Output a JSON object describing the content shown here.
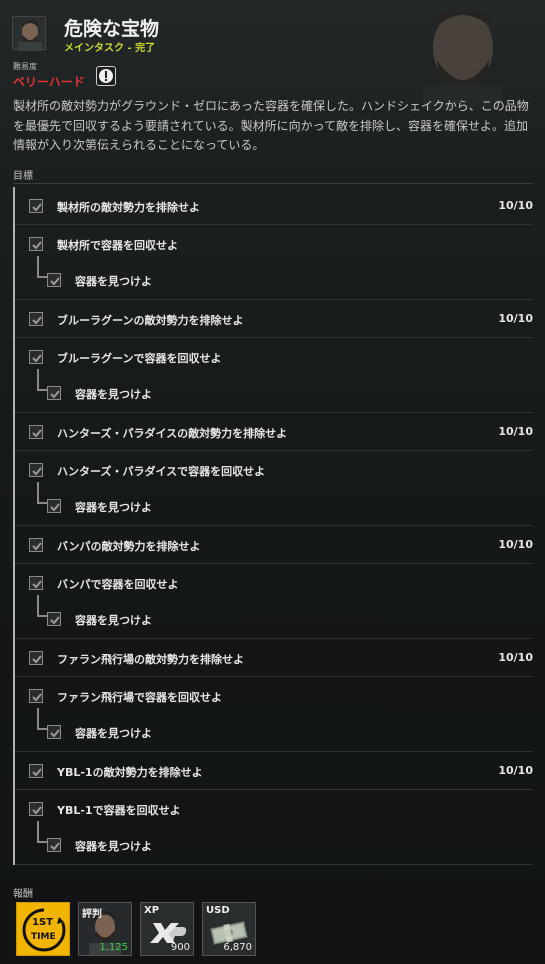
{
  "quest": {
    "title": "危険な宝物",
    "subtitle": "メインタスク - 完了",
    "difficulty_label": "難易度",
    "difficulty": "ベリーハード",
    "description": "製材所の敵対勢力がグラウンド・ゼロにあった容器を確保した。ハンドシェイクから、この品物を最優先で回収するよう要請されている。製材所に向かって敵を排除し、容器を確保せよ。追加情報が入り次第伝えられることになっている。"
  },
  "objectives_label": "目標",
  "objectives": [
    {
      "text": "製材所の敵対勢力を排除せよ",
      "count": "10/10"
    },
    {
      "text": "製材所で容器を回収せよ",
      "sub": "容器を見つけよ"
    },
    {
      "text": "ブルーラグーンの敵対勢力を排除せよ",
      "count": "10/10"
    },
    {
      "text": "ブルーラグーンで容器を回収せよ",
      "sub": "容器を見つけよ"
    },
    {
      "text": "ハンターズ・パラダイスの敵対勢力を排除せよ",
      "count": "10/10"
    },
    {
      "text": "ハンターズ・パラダイスで容器を回収せよ",
      "sub": "容器を見つけよ"
    },
    {
      "text": "バンパの敵対勢力を排除せよ",
      "count": "10/10"
    },
    {
      "text": "バンパで容器を回収せよ",
      "sub": "容器を見つけよ"
    },
    {
      "text": "ファラン飛行場の敵対勢力を排除せよ",
      "count": "10/10"
    },
    {
      "text": "ファラン飛行場で容器を回収せよ",
      "sub": "容器を見つけよ"
    },
    {
      "text": "YBL-1の敵対勢力を排除せよ",
      "count": "10/10"
    },
    {
      "text": "YBL-1で容器を回収せよ",
      "sub": "容器を見つけよ"
    }
  ],
  "rewards_label": "報酬",
  "rewards": {
    "first_time": {
      "text_top": "1ST",
      "text_bottom": "TIME"
    },
    "reputation": {
      "title": "評判",
      "value": "1,125"
    },
    "xp": {
      "title": "XP",
      "value": "900"
    },
    "usd": {
      "title": "USD",
      "value": "6,870"
    }
  },
  "colors": {
    "subtitle": "#cddc2e",
    "difficulty": "#e03434",
    "first_time_bg": "#f1b400",
    "reputation_value": "#3fcf3f"
  }
}
